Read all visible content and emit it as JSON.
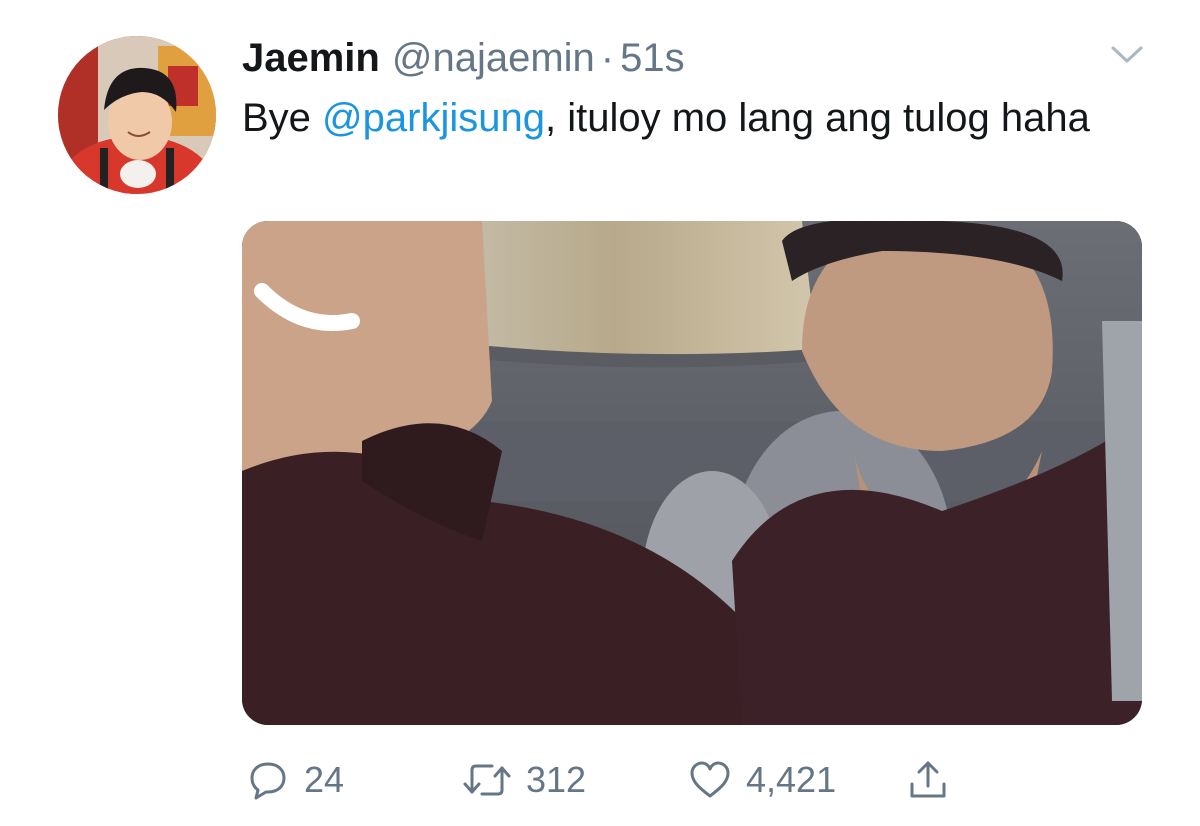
{
  "tweet": {
    "author": {
      "display_name": "Jaemin",
      "handle": "@najaemin",
      "separator": "·",
      "timestamp": "51s"
    },
    "text": {
      "lead": "Bye ",
      "mention": "@parkjisung",
      "rest": ", ituloy mo lang ang tulog haha"
    },
    "actions": {
      "replies": "24",
      "retweets": "312",
      "likes": "4,421"
    },
    "icons": [
      "caret-down-icon",
      "reply-icon",
      "retweet-icon",
      "like-icon",
      "share-icon"
    ],
    "colors": {
      "text": "#14171a",
      "secondary": "#657786",
      "link": "#1b95e0"
    }
  }
}
